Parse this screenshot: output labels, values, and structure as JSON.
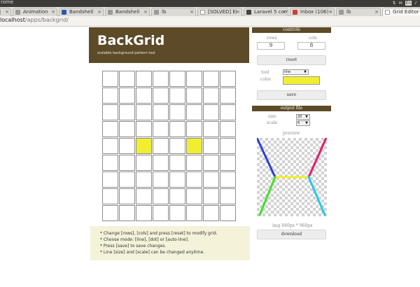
{
  "os": {
    "app_title": "rome",
    "tray": {
      "keyboard": "En",
      "time": ""
    }
  },
  "browser": {
    "tabs": [
      {
        "label": "",
        "favicon_color": "#9a9a9a"
      },
      {
        "label": "Animation",
        "favicon_color": "#9a9a9a"
      },
      {
        "label": "Bandshell",
        "favicon_color": "#2b57b0"
      },
      {
        "label": "Bandshell",
        "favicon_color": "#9a9a9a"
      },
      {
        "label": "lb",
        "favicon_color": "#9a9a9a"
      },
      {
        "label": "[SOLVED] Ei",
        "favicon_color": "#ffffff"
      },
      {
        "label": "Laravel 5 com",
        "favicon_color": "#444444"
      },
      {
        "label": "Inbox (106) -",
        "favicon_color": "#c94135"
      },
      {
        "label": "lb",
        "favicon_color": "#9a9a9a"
      },
      {
        "label": "Grid Editor",
        "favicon_color": "#ffffff"
      }
    ],
    "url_host": "localhost",
    "url_path": "/apps/backgrid/"
  },
  "header": {
    "title": "BackGrid",
    "subtitle": "scalable background pattern tool"
  },
  "grid": {
    "rows": 9,
    "cols": 8,
    "filled": [
      [
        4,
        2
      ],
      [
        4,
        5
      ]
    ],
    "fill_color": "#f1ee2f"
  },
  "help": {
    "lines": [
      "* Change [rows], [cols] and press [reset] to modify grid.",
      "* Choose mode: [line], [dot] or [auto-line].",
      "* Press [save] to save changes.",
      "* Line [size] and [scale] can be changed anytime."
    ]
  },
  "controls": {
    "heading": "controls",
    "rows_label": "rows",
    "rows_value": "9",
    "cols_label": "cols",
    "cols_value": "8",
    "reset_label": "reset",
    "tool_label": "tool",
    "tool_value": "line",
    "color_label": "color",
    "color_value": "#f1ee2f",
    "save_label": "save"
  },
  "output": {
    "heading": "output file",
    "size_label": "size",
    "size_value": "20",
    "scale_label": "scale",
    "scale_value": "6",
    "preview_label": "preview",
    "dimensions": "img 840px * 960px",
    "download_label": "download"
  },
  "colors": {
    "brand": "#5c4a28",
    "preview_lines": [
      "#2b3fd6",
      "#e01f6a",
      "#f1ee2f",
      "#43e02a",
      "#28c8e6"
    ]
  }
}
